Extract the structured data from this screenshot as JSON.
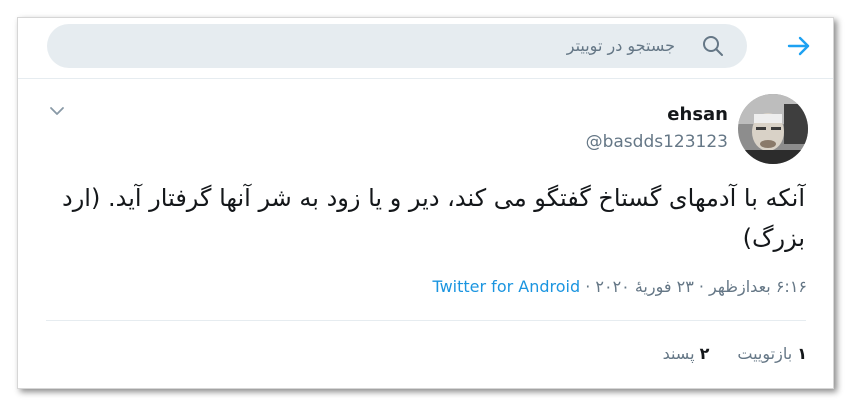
{
  "search": {
    "placeholder": "جستجو در توییتر"
  },
  "user": {
    "name": "ehsan",
    "handle": "@basdds123123"
  },
  "tweet": {
    "text": "آنکه با آدمهای گستاخ گفتگو می کند، دیر و یا زود به شر آنها گرفتار آید. (ارد بزرگ)",
    "timestamp": "۶:۱۶ بعدازظهر · ۲۳ فوریهٔ ۲۰۲۰",
    "separator": " · ",
    "source": "Twitter for Android"
  },
  "stats": {
    "retweets_count": "۱",
    "retweets_label": "بازتوییت",
    "likes_count": "۲",
    "likes_label": "پسند"
  },
  "icons": {
    "back": "arrow-right-icon",
    "search": "search-icon",
    "caret": "chevron-down-icon"
  },
  "colors": {
    "accent": "#1da1f2",
    "link": "#1b95e0",
    "muted": "#657786",
    "search_bg": "#e6ecf0"
  }
}
